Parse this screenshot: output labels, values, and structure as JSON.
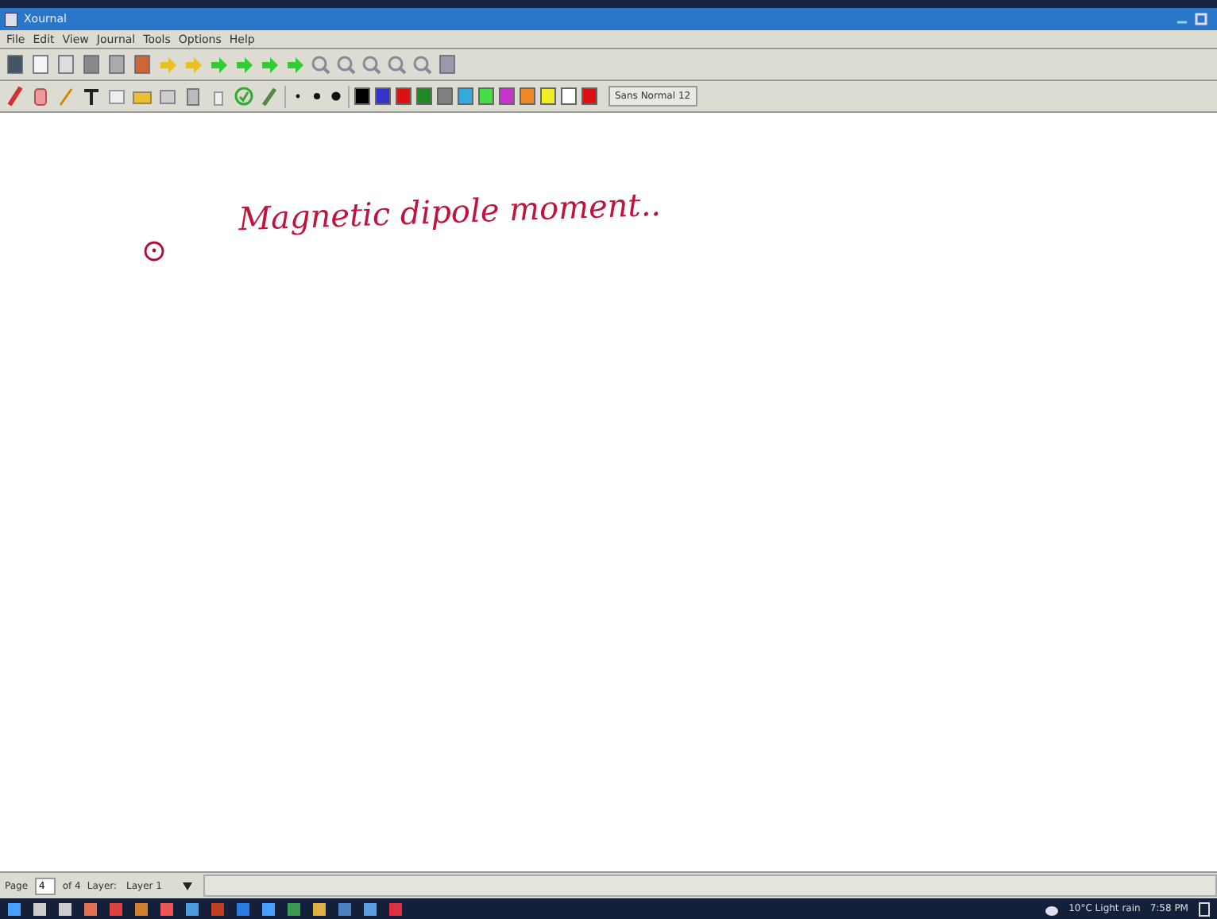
{
  "window": {
    "title": "Xournal"
  },
  "menu": [
    "File",
    "Edit",
    "View",
    "Journal",
    "Tools",
    "Options",
    "Help"
  ],
  "toolbar": {
    "font_button": "Sans Normal 12"
  },
  "palette": [
    {
      "color": "#000000"
    },
    {
      "color": "#3333cc"
    },
    {
      "color": "#dd1111"
    },
    {
      "color": "#228822"
    },
    {
      "color": "#808080"
    },
    {
      "color": "#33aadd"
    },
    {
      "color": "#44dd44"
    },
    {
      "color": "#cc33cc"
    },
    {
      "color": "#ee8822"
    },
    {
      "color": "#eeee22"
    },
    {
      "color": "#ffffff"
    },
    {
      "color": "#dd1111"
    }
  ],
  "canvas": {
    "heading": "Magnetic dipole moment.."
  },
  "status_bar": {
    "page_label": "Page",
    "page_value": "4",
    "page_count": "of 4",
    "layer_label": "Layer:",
    "layer_value": "Layer 1"
  },
  "taskbar": {
    "weather": "10°C Light rain",
    "time": "7:58 PM"
  }
}
